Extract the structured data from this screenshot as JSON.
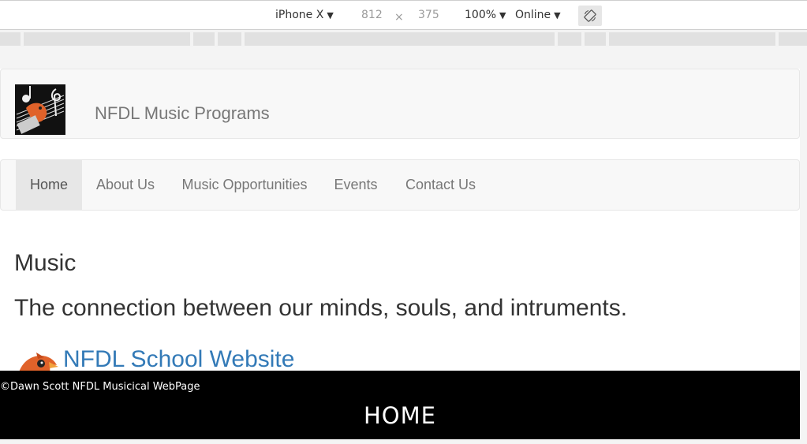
{
  "devtools": {
    "device": "iPhone X",
    "width": "812",
    "separator": "×",
    "height": "375",
    "zoom": "100%",
    "network": "Online",
    "rotate_icon": "rotate-icon"
  },
  "site": {
    "title": "NFDL Music Programs",
    "nav": [
      {
        "label": "Home",
        "active": true
      },
      {
        "label": "About Us"
      },
      {
        "label": "Music Opportunities"
      },
      {
        "label": "Events"
      },
      {
        "label": "Contact Us"
      }
    ],
    "heading": "Music",
    "tagline": "The connection between our minds, souls, and intruments.",
    "school_link": "NFDL School Website",
    "footer": {
      "copyright": "©Dawn Scott NFDL Musicical WebPage",
      "home_link": "HOME"
    }
  },
  "colors": {
    "link": "#337ab7",
    "nav_text": "#777777",
    "footer_bg": "#000000",
    "bird": "#e0622a"
  }
}
